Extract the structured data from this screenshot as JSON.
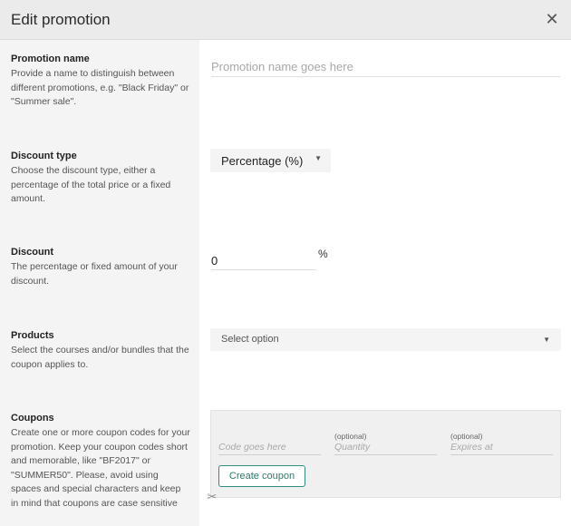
{
  "header": {
    "title": "Edit promotion",
    "close_icon": "close-icon"
  },
  "sections": {
    "promotion_name": {
      "title": "Promotion name",
      "description": "Provide a name to distinguish between different promotions, e.g. \"Black Friday\" or \"Summer sale\".",
      "input_placeholder": "Promotion name goes here",
      "input_value": ""
    },
    "discount_type": {
      "title": "Discount type",
      "description": "Choose the discount type, either a percentage of the total price or a fixed amount.",
      "selected": "Percentage (%)"
    },
    "discount": {
      "title": "Discount",
      "description": "The percentage or fixed amount of your discount.",
      "value": "0",
      "unit": "%"
    },
    "products": {
      "title": "Products",
      "description": "Select the courses and/or bundles that the coupon applies to.",
      "selected": "Select option"
    },
    "coupons": {
      "title": "Coupons",
      "description": "Create one or more coupon codes for your promotion. Keep your coupon codes short and memorable, like \"BF2017\" or \"SUMMER50\". Please, avoid using spaces and special characters and keep in mind that coupons are case sensitive",
      "code_placeholder": "Code goes here",
      "quantity_optional": "(optional)",
      "quantity_placeholder": "Quantity",
      "expires_optional": "(optional)",
      "expires_placeholder": "Expires at",
      "create_button": "Create coupon"
    }
  }
}
